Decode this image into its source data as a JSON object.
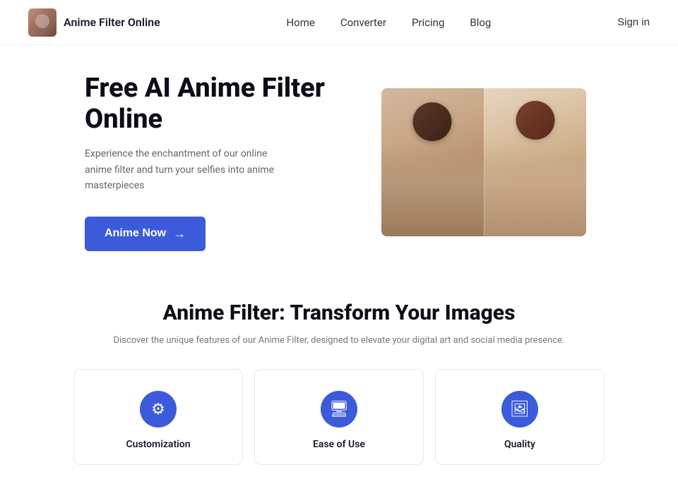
{
  "navbar": {
    "brand_name": "Anime Filter Online",
    "links": [
      {
        "label": "Home",
        "id": "home"
      },
      {
        "label": "Converter",
        "id": "converter"
      },
      {
        "label": "Pricing",
        "id": "pricing"
      },
      {
        "label": "Blog",
        "id": "blog"
      }
    ],
    "signin_label": "Sign in"
  },
  "hero": {
    "title": "Free AI Anime Filter Online",
    "subtitle": "Experience the enchantment of our online anime filter and turn your selfies into anime masterpieces",
    "cta_label": "Anime Now",
    "cta_arrow": "→"
  },
  "features": {
    "title": "Anime Filter: Transform Your Images",
    "subtitle": "Discover the unique features of our Anime Filter, designed to\nelevate your digital art and social media presence.",
    "cards": [
      {
        "id": "customization",
        "label": "Customization",
        "icon": "⚙"
      },
      {
        "id": "ease-of-use",
        "label": "Ease of Use",
        "icon": "🖥"
      },
      {
        "id": "quality",
        "label": "Quality",
        "icon": "🖼"
      }
    ]
  }
}
